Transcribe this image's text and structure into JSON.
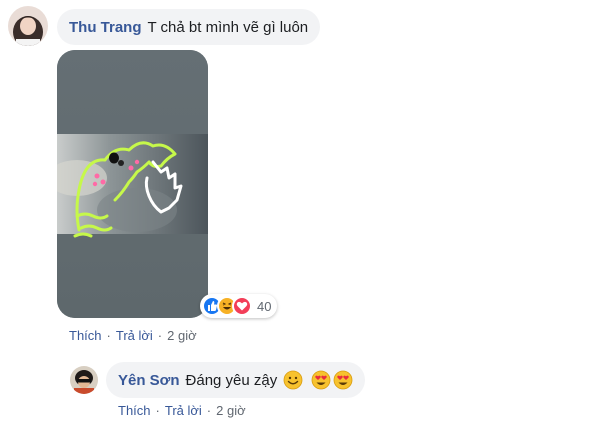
{
  "comment": {
    "author": "Thu Trang",
    "text": "T chả bt mình vẽ gì luôn",
    "reactions": {
      "icons": [
        "like-icon",
        "haha-icon",
        "love-icon"
      ],
      "count": "40"
    },
    "actions": {
      "like": "Thích",
      "reply": "Trả lời",
      "time": "2 giờ",
      "separator": "·"
    }
  },
  "reply": {
    "author": "Yên Sơn",
    "text": "Đáng yêu zậy",
    "emojis": [
      "smile-emoji",
      "heart-eyes-emoji",
      "heart-eyes-emoji"
    ],
    "actions": {
      "like": "Thích",
      "reply": "Trả lời",
      "time": "2 giờ",
      "separator": "·"
    }
  },
  "colors": {
    "author_link": "#385898",
    "bubble_bg": "#f2f3f5",
    "meta_text": "#606770",
    "like_blue": "#1877f2",
    "love_red": "#f33e58",
    "haha_yellow": "#f7b125",
    "doodle_green": "#c6f84a"
  }
}
